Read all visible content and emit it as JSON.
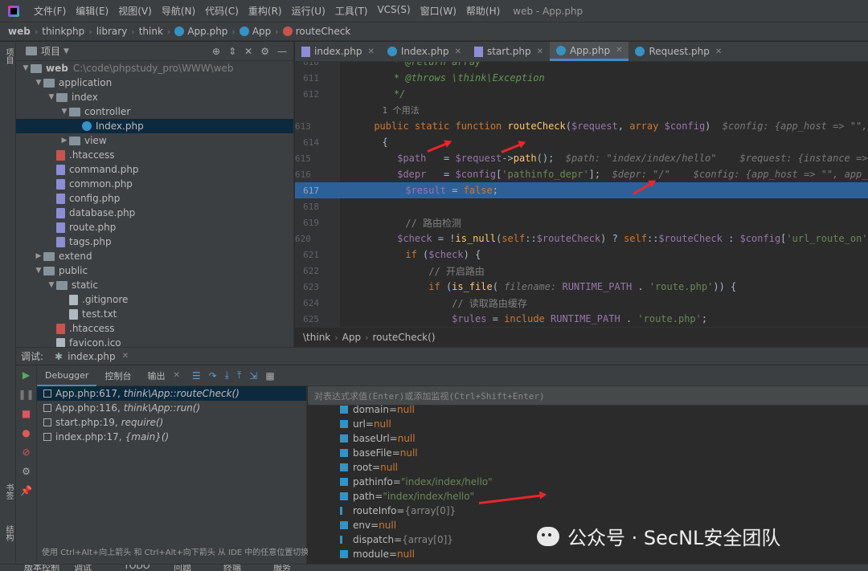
{
  "menu": {
    "items": [
      "文件(F)",
      "编辑(E)",
      "视图(V)",
      "导航(N)",
      "代码(C)",
      "重构(R)",
      "运行(U)",
      "工具(T)",
      "VCS(S)",
      "窗口(W)",
      "帮助(H)"
    ],
    "window_title": "web - App.php"
  },
  "breadcrumb": {
    "items": [
      "web",
      "thinkphp",
      "library",
      "think",
      "App.php",
      "App",
      "routeCheck"
    ]
  },
  "left_strip": {
    "project_label": "项目",
    "bookmarks_label": "书签",
    "structure_label": "结构"
  },
  "project": {
    "header": "项目",
    "tree": [
      {
        "label": "web",
        "extra": "C:\\code\\phpstudy_pro\\WWW\\web",
        "depth": 0,
        "type": "folder",
        "open": true
      },
      {
        "label": "application",
        "depth": 1,
        "type": "folder",
        "open": true
      },
      {
        "label": "index",
        "depth": 2,
        "type": "folder",
        "open": true
      },
      {
        "label": "controller",
        "depth": 3,
        "type": "folder",
        "open": true
      },
      {
        "label": "Index.php",
        "depth": 4,
        "type": "class",
        "selected": true
      },
      {
        "label": "view",
        "depth": 3,
        "type": "folder",
        "open": false
      },
      {
        "label": ".htaccess",
        "depth": 2,
        "type": "ht"
      },
      {
        "label": "command.php",
        "depth": 2,
        "type": "php"
      },
      {
        "label": "common.php",
        "depth": 2,
        "type": "php"
      },
      {
        "label": "config.php",
        "depth": 2,
        "type": "php"
      },
      {
        "label": "database.php",
        "depth": 2,
        "type": "php"
      },
      {
        "label": "route.php",
        "depth": 2,
        "type": "php"
      },
      {
        "label": "tags.php",
        "depth": 2,
        "type": "php"
      },
      {
        "label": "extend",
        "depth": 1,
        "type": "folder",
        "open": false
      },
      {
        "label": "public",
        "depth": 1,
        "type": "folder",
        "open": true
      },
      {
        "label": "static",
        "depth": 2,
        "type": "folder",
        "open": true
      },
      {
        "label": ".gitignore",
        "depth": 3,
        "type": "txt"
      },
      {
        "label": "test.txt",
        "depth": 3,
        "type": "txt"
      },
      {
        "label": ".htaccess",
        "depth": 2,
        "type": "ht"
      },
      {
        "label": "favicon.ico",
        "depth": 2,
        "type": "txt"
      }
    ]
  },
  "editor_tabs": [
    {
      "label": "index.php",
      "icon": "php"
    },
    {
      "label": "Index.php",
      "icon": "class"
    },
    {
      "label": "start.php",
      "icon": "php"
    },
    {
      "label": "App.php",
      "icon": "class",
      "active": true
    },
    {
      "label": "Request.php",
      "icon": "class"
    }
  ],
  "code": {
    "lines": [
      {
        "n": "610",
        "html": "    <span class='doc'>* @return array</span>"
      },
      {
        "n": "611",
        "html": "    <span class='doc'>* @throws \\think\\Exception</span>"
      },
      {
        "n": "612",
        "html": "    <span class='doc'>*/</span>"
      },
      {
        "n": "",
        "html": "  <span class='usages'>1 个用法</span>"
      },
      {
        "n": "613",
        "html": "  <span class='kw'>public static function </span><span class='fn'>routeCheck</span>(<span class='var'>$request</span>, <span class='kw'>array </span><span class='var'>$config</span>)  <span class='hint'>$config: {app_host => \"\", app_</span>"
      },
      {
        "n": "614",
        "html": "  {"
      },
      {
        "n": "615",
        "html": "      <span class='var'>$path</span>   = <span class='var'>$request</span>-&gt;<span class='fn'>path</span>();  <span class='hint'>$path: \"index/index/hello\"    $request: {instance => null,</span>"
      },
      {
        "n": "616",
        "html": "      <span class='var'>$depr</span>   = <span class='var'>$config</span>[<span class='str'>'pathinfo_depr'</span>];  <span class='hint'>$depr: \"/\"    $config: {app_host => \"\", app_debug</span>"
      },
      {
        "n": "617",
        "html": "      <span class='var'>$result</span> = <span class='kw'>false</span>;",
        "highlight": true
      },
      {
        "n": "618",
        "html": ""
      },
      {
        "n": "619",
        "html": "      <span class='cmt'>// 路由检测</span>"
      },
      {
        "n": "620",
        "html": "      <span class='var'>$check</span> = !<span class='fn'>is_null</span>(<span class='kw'>self</span>::<span class='var'>$routeCheck</span>) ? <span class='kw'>self</span>::<span class='var'>$routeCheck</span> : <span class='var'>$config</span>[<span class='str'>'url_route_on'</span>]"
      },
      {
        "n": "621",
        "html": "      <span class='kw'>if </span>(<span class='var'>$check</span>) {"
      },
      {
        "n": "622",
        "html": "          <span class='cmt'>// 开启路由</span>"
      },
      {
        "n": "623",
        "html": "          <span class='kw'>if </span>(<span class='fn'>is_file</span>( <span class='hint'>filename:</span> <span class='var'>RUNTIME_PATH</span> . <span class='str'>'route.php'</span>)) {"
      },
      {
        "n": "624",
        "html": "              <span class='cmt'>// 读取路由缓存</span>"
      },
      {
        "n": "625",
        "html": "              <span class='var'>$rules</span> = <span class='kw'>include </span><span class='var'>RUNTIME_PATH</span> . <span class='str'>'route.php'</span>;"
      }
    ]
  },
  "editor_crumb": [
    "\\think",
    "App",
    "routeCheck()"
  ],
  "debug": {
    "label": "调试:",
    "session": "index.php",
    "tabs": [
      "Debugger",
      "控制台",
      "输出"
    ],
    "eval_placeholder": "对表达式求值(Enter)或添加监视(Ctrl+Shift+Enter)",
    "frames": [
      {
        "loc": "App.php:617,",
        "fn": "think\\App::routeCheck()",
        "selected": true
      },
      {
        "loc": "App.php:116,",
        "fn": "think\\App::run()"
      },
      {
        "loc": "start.php:19,",
        "fn": "require()"
      },
      {
        "loc": "index.php:17,",
        "fn": "{main}()"
      }
    ],
    "frames_tip": "使用 Ctrl+Alt+向上箭头 和 Ctrl+Alt+向下箭头 从 IDE 中的任意位置切换帧",
    "variables": [
      {
        "name": "domain",
        "value": "null",
        "kind": "null"
      },
      {
        "name": "url",
        "value": "null",
        "kind": "null"
      },
      {
        "name": "baseUrl",
        "value": "null",
        "kind": "null"
      },
      {
        "name": "baseFile",
        "value": "null",
        "kind": "null"
      },
      {
        "name": "root",
        "value": "null",
        "kind": "null"
      },
      {
        "name": "pathinfo",
        "value": "\"index/index/hello\"",
        "kind": "str"
      },
      {
        "name": "path",
        "value": "\"index/index/hello\"",
        "kind": "str"
      },
      {
        "name": "routeInfo",
        "value": "{array[0]}",
        "kind": "arr"
      },
      {
        "name": "env",
        "value": "null",
        "kind": "null"
      },
      {
        "name": "dispatch",
        "value": "{array[0]}",
        "kind": "arr"
      },
      {
        "name": "module",
        "value": "null",
        "kind": "null"
      }
    ]
  },
  "status_bar": [
    "版本控制",
    "调试",
    "TODO",
    "问题",
    "终端",
    "服务"
  ],
  "watermark": "公众号 · SecNL安全团队",
  "colors": {
    "accent": "#4a88c7",
    "highlight_line": "#2d6099",
    "annotation_arrow": "#e8262b"
  }
}
